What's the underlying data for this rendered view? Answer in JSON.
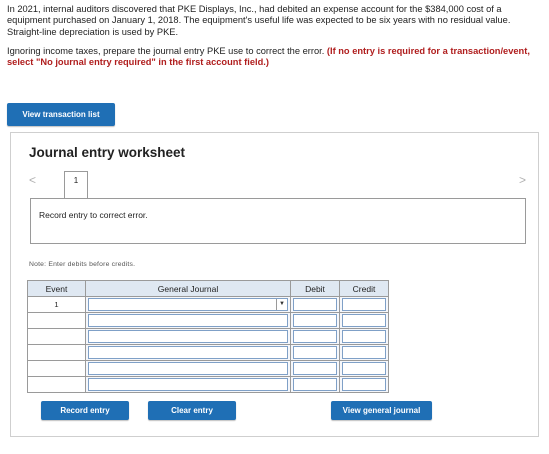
{
  "problem": {
    "paragraph1": "In 2021, internal auditors discovered that PKE Displays, Inc., had debited an expense account for the $384,000 cost of a equipment purchased on January 1, 2018. The equipment's useful life was expected to be six years with no residual value. Straight-line depreciation is used by PKE.",
    "paragraph2_plain": "Ignoring income taxes, prepare the journal entry PKE use to correct the error. ",
    "paragraph2_required": "(If no entry is required for a transaction/event, select \"No journal entry required\" in the first account field.)"
  },
  "buttons": {
    "view_transaction_list": "View transaction list",
    "record_entry": "Record entry",
    "clear_entry": "Clear entry",
    "view_general_journal": "View general journal"
  },
  "worksheet": {
    "title": "Journal entry worksheet",
    "nav_prev": "<",
    "nav_next": ">",
    "current_tab": "1",
    "instruction": "Record entry to correct error.",
    "note": "Note: Enter debits before credits."
  },
  "table": {
    "headers": [
      "Event",
      "General Journal",
      "Debit",
      "Credit"
    ],
    "rows": [
      {
        "event": "1"
      },
      {
        "event": ""
      },
      {
        "event": ""
      },
      {
        "event": ""
      },
      {
        "event": ""
      },
      {
        "event": ""
      }
    ]
  },
  "colors": {
    "button_blue": "#1f6fb5",
    "required_red": "#b01e1e",
    "header_bg": "#dfe8f2"
  },
  "icons": {
    "prev": "chevron-left-icon",
    "next": "chevron-right-icon",
    "dropdown": "caret-down-icon"
  }
}
